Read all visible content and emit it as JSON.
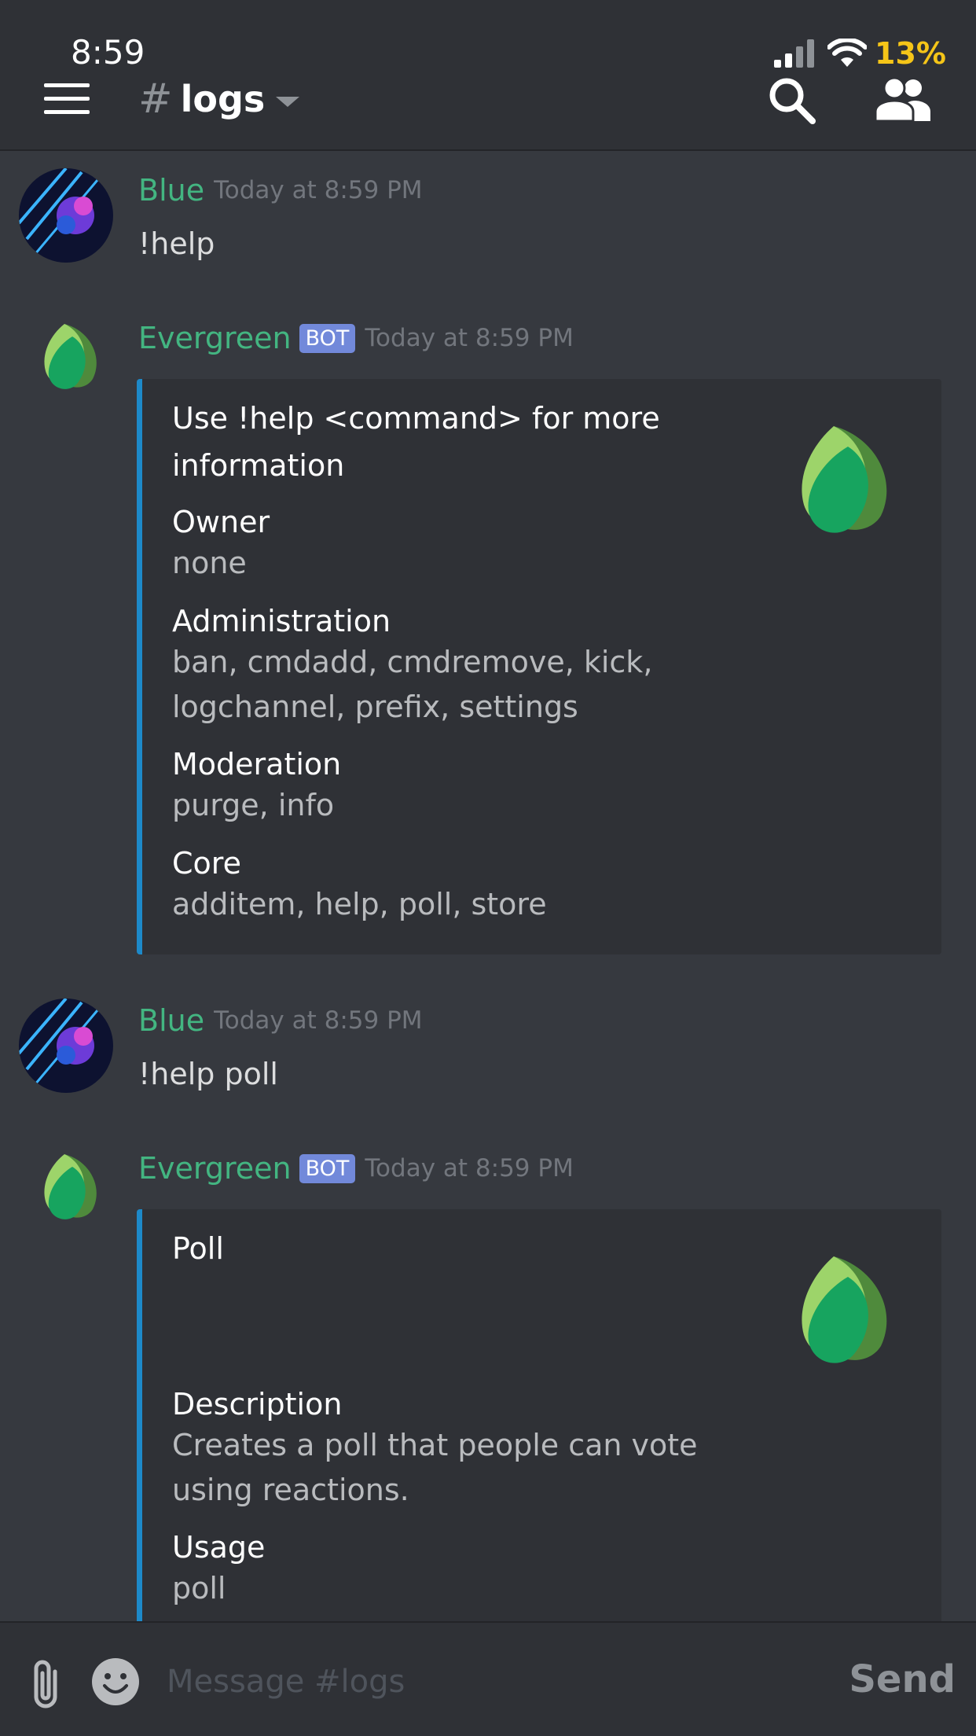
{
  "status_bar": {
    "time": "8:59",
    "battery": "13%",
    "battery_color": "#f5c518"
  },
  "header": {
    "hash": "#",
    "channel": "logs",
    "icons": [
      "menu-icon",
      "search-icon",
      "members-icon"
    ]
  },
  "messages": [
    {
      "author": "Blue",
      "timestamp": "Today at 8:59 PM",
      "text": "!help"
    },
    {
      "author": "Evergreen",
      "badge": "BOT",
      "timestamp": "Today at 8:59 PM",
      "embed": {
        "title_line1": "Use !help <command> for more",
        "title_line2": "information",
        "fields": [
          {
            "name": "Owner",
            "value_lines": [
              "none"
            ]
          },
          {
            "name": "Administration",
            "value_lines": [
              "ban, cmdadd, cmdremove, kick,",
              "logchannel, prefix, settings"
            ]
          },
          {
            "name": "Moderation",
            "value_lines": [
              "purge, info"
            ]
          },
          {
            "name": "Core",
            "value_lines": [
              "additem, help, poll, store"
            ]
          }
        ]
      }
    },
    {
      "author": "Blue",
      "timestamp": "Today at 8:59 PM",
      "text": "!help poll"
    },
    {
      "author": "Evergreen",
      "badge": "BOT",
      "timestamp": "Today at 8:59 PM",
      "embed": {
        "title": "Poll",
        "fields": [
          {
            "name": "Description",
            "value_lines": [
              "Creates a poll that people can vote",
              "using reactions."
            ]
          },
          {
            "name": "Usage",
            "value_lines": [
              "poll"
            ]
          }
        ]
      }
    }
  ],
  "composer": {
    "placeholder": "Message #logs",
    "send": "Send"
  },
  "colors": {
    "username": "#43b581",
    "embed_accent": "#1d89c9",
    "bot_badge": "#7289da"
  }
}
